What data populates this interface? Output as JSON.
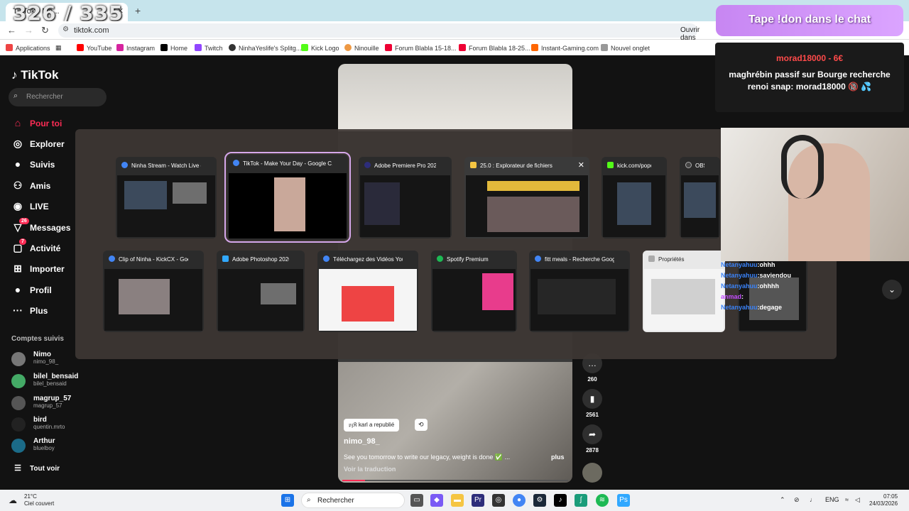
{
  "overlay_counter": "326 / 335",
  "browser": {
    "tab_title": "TikTok - Ma...",
    "url": "tiktok.com",
    "open_in_app": "Ouvrir dans l'appli",
    "bookmarks": [
      "Applications",
      "YouTube",
      "Instagram",
      "Home",
      "Twitch",
      "NinhaYeslife's Splitg...",
      "Kick Logo",
      "Ninouille",
      "Forum Blabla 15-18...",
      "Forum Blabla 18-25...",
      "Instant-Gaming.com",
      "Nouvel onglet"
    ]
  },
  "tiktok": {
    "logo": "TikTok",
    "search_placeholder": "Rechercher",
    "nav": [
      {
        "label": "Pour toi",
        "icon": "home-icon"
      },
      {
        "label": "Explorer",
        "icon": "compass-icon"
      },
      {
        "label": "Suivis",
        "icon": "following-icon"
      },
      {
        "label": "Amis",
        "icon": "friends-icon"
      },
      {
        "label": "LIVE",
        "icon": "live-icon"
      },
      {
        "label": "Messages",
        "icon": "messages-icon",
        "badge": "26"
      },
      {
        "label": "Activité",
        "icon": "activity-icon",
        "badge": "7"
      },
      {
        "label": "Importer",
        "icon": "upload-icon"
      },
      {
        "label": "Profil",
        "icon": "profile-icon"
      },
      {
        "label": "Plus",
        "icon": "more-icon"
      }
    ],
    "accounts_title": "Comptes suivis",
    "accounts": [
      {
        "name": "Nimo",
        "handle": "nimo_98_"
      },
      {
        "name": "bilel_bensaid",
        "handle": "bilel_bensaid"
      },
      {
        "name": "magrup_57",
        "handle": "magrup_57"
      },
      {
        "name": "bird",
        "handle": "quentin.mrto"
      },
      {
        "name": "Arthur",
        "handle": "bluelboy"
      }
    ],
    "see_all": "Tout voir",
    "video": {
      "repost": "𝔭𝔷𝔎 karl a republié",
      "username": "nimo_98_",
      "description": "See you tomorrow to write our legacy, weight is done ✅ ...",
      "more": "plus",
      "translate": "Voir la traduction",
      "progress": 0.1,
      "actions": [
        {
          "icon": "comment-icon",
          "count": "260"
        },
        {
          "icon": "bookmark-icon",
          "count": "2561"
        },
        {
          "icon": "share-icon",
          "count": "2878"
        }
      ]
    }
  },
  "switcher": {
    "row1": [
      {
        "title": "Ninha Stream - Watch Live o...",
        "icon_color": "#4285f4"
      },
      {
        "title": "TikTok - Make Your Day - Google C...",
        "icon_color": "#4285f4",
        "selected": true
      },
      {
        "title": "Adobe Premiere Pro 2025...",
        "icon_color": "#2d2d7a"
      },
      {
        "title": "25.0 : Explorateur de fichiers",
        "icon_color": "#f5c542",
        "close": "✕"
      },
      {
        "title": "kick.com/popo...",
        "icon_color": "#53fc18"
      },
      {
        "title": "OBS 32.0...",
        "icon_color": "#444"
      }
    ],
    "row2": [
      {
        "title": "Clip of Ninha - KickCX - Goo...",
        "icon_color": "#4285f4"
      },
      {
        "title": "Adobe Photoshop 2026",
        "icon_color": "#31a8ff"
      },
      {
        "title": "Téléchargez des Vidéos YouT...",
        "icon_color": "#4285f4"
      },
      {
        "title": "Spotify Premium",
        "icon_color": "#1db954"
      },
      {
        "title": "fitt meals - Recherche Googl...",
        "icon_color": "#4285f4"
      },
      {
        "title": "Propriétés",
        "icon_color": "#aaa"
      }
    ]
  },
  "stream": {
    "don_text": "Tape !don dans le chat",
    "alert_title": "morad18000 - 6€",
    "alert_message": "maghrébin passif sur Bourge recherche renoi snap: morad18000 🔞 💦",
    "chat": [
      {
        "user": "Netanyahuu",
        "msg": ":ohhh"
      },
      {
        "user": "Netanyahuu",
        "msg": ":saviendou"
      },
      {
        "user": "Netanyahuu",
        "msg": ":ohhhh"
      },
      {
        "user": "anmad",
        "msg": ":"
      },
      {
        "user": "Netanyahuu",
        "msg": ":degage"
      }
    ]
  },
  "taskbar": {
    "temp": "21°C",
    "weather": "Ciel couvert",
    "search": "Rechercher",
    "lang": "ENG",
    "time": "07:05",
    "date": "24/03/2026"
  }
}
